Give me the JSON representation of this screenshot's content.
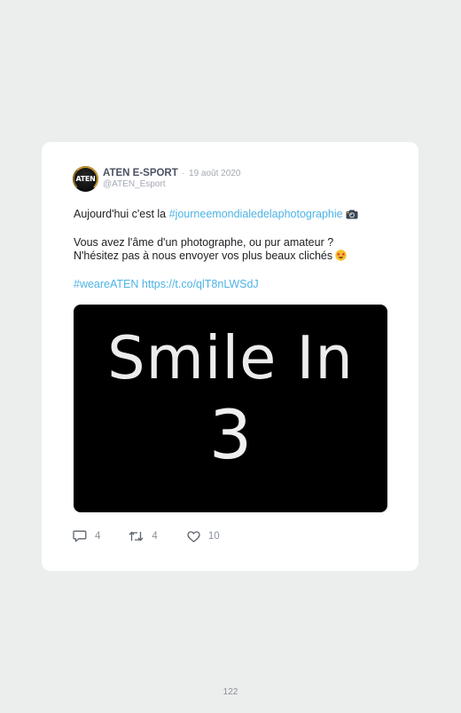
{
  "tweet": {
    "author_name": "ATEN E-SPORT",
    "separator": "·",
    "date": "19 août 2020",
    "handle": "@ATEN_Esport",
    "avatar_text": "ATEN",
    "line1_prefix": "Aujourd'hui c'est la ",
    "line1_hashtag": "#journeemondialedelaphotographie",
    "line1_emoji": "camera-with-flash-emoji",
    "line2": "Vous avez l'âme d'un photographe, ou pur amateur ?",
    "line3": "N'hésitez pas à nous envoyer vos plus beaux clichés",
    "line3_emoji": "star-struck-emoji",
    "hashtag2": "#weareATEN",
    "link": "https://t.co/qlT8nLWSdJ",
    "media_text_line1": "Smile In",
    "media_text_line2": "3",
    "replies": "4",
    "retweets": "4",
    "likes": "10",
    "link_color": "#4db3e6"
  },
  "page_number": "122"
}
